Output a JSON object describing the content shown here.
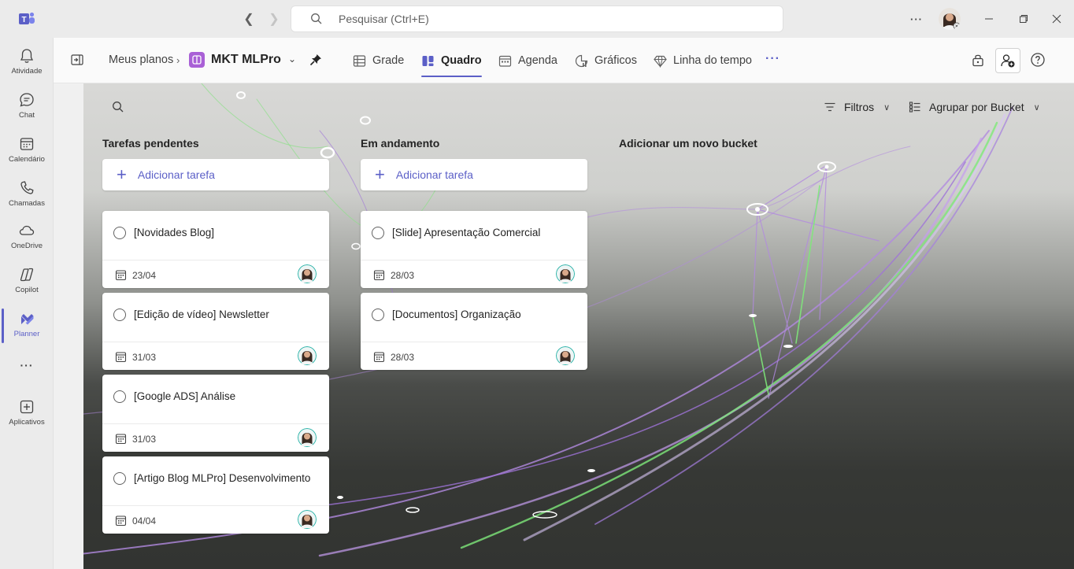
{
  "titlebar": {
    "search_placeholder": "Pesquisar (Ctrl+E)",
    "more": "···"
  },
  "rail": {
    "items": [
      {
        "label": "Atividade",
        "icon": "bell-icon"
      },
      {
        "label": "Chat",
        "icon": "chat-icon"
      },
      {
        "label": "Calendário",
        "icon": "calendar-icon"
      },
      {
        "label": "Chamadas",
        "icon": "phone-icon"
      },
      {
        "label": "OneDrive",
        "icon": "cloud-icon"
      },
      {
        "label": "Copilot",
        "icon": "copilot-icon"
      },
      {
        "label": "Planner",
        "icon": "planner-icon",
        "active": true
      },
      {
        "label": "···",
        "icon": "more-icon"
      },
      {
        "label": "Aplicativos",
        "icon": "apps-add-icon"
      }
    ]
  },
  "header": {
    "breadcrumb": "Meus planos",
    "plan_name": "MKT MLPro",
    "tabs": [
      {
        "label": "Grade",
        "icon": "grid-icon"
      },
      {
        "label": "Quadro",
        "icon": "board-icon",
        "active": true
      },
      {
        "label": "Agenda",
        "icon": "schedule-icon"
      },
      {
        "label": "Gráficos",
        "icon": "charts-icon"
      },
      {
        "label": "Linha do tempo",
        "icon": "timeline-icon"
      }
    ],
    "more": "···"
  },
  "toolbar": {
    "filters_label": "Filtros",
    "group_label": "Agrupar por Bucket"
  },
  "buckets": [
    {
      "title": "Tarefas pendentes",
      "add_label": "Adicionar tarefa",
      "tasks": [
        {
          "title": "[Novidades Blog]",
          "due": "23/04"
        },
        {
          "title": "[Edição de vídeo] Newsletter",
          "due": "31/03"
        },
        {
          "title": "[Google ADS] Análise",
          "due": "31/03"
        },
        {
          "title": "[Artigo Blog MLPro] Desenvolvimento",
          "due": "04/04"
        }
      ]
    },
    {
      "title": "Em andamento",
      "add_label": "Adicionar tarefa",
      "tasks": [
        {
          "title": "[Slide] Apresentação Comercial",
          "due": "28/03"
        },
        {
          "title": "[Documentos] Organização",
          "due": "28/03"
        }
      ]
    }
  ],
  "new_bucket_label": "Adicionar um novo bucket",
  "colors": {
    "accent": "#5b5fc7",
    "planner": "#a960d6"
  }
}
